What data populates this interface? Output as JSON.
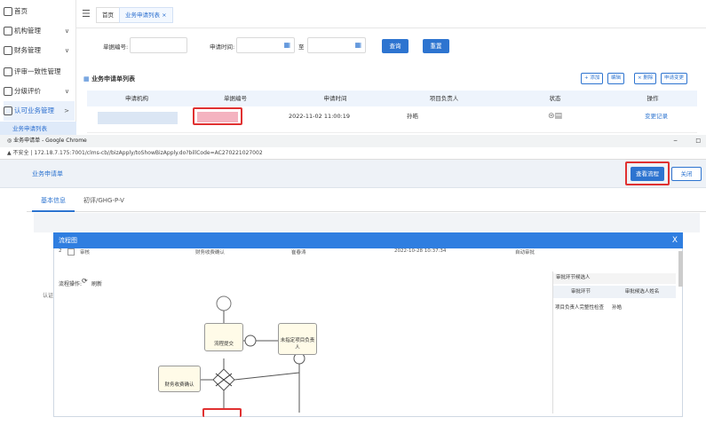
{
  "sidebar": {
    "items": [
      {
        "label": "首页",
        "icon": "home-icon",
        "chev": ""
      },
      {
        "label": "机构管理",
        "icon": "org-icon",
        "chev": "∨"
      },
      {
        "label": "财务管理",
        "icon": "finance-icon",
        "chev": "∨"
      },
      {
        "label": "评审一致性管理",
        "icon": "review-icon",
        "chev": ""
      },
      {
        "label": "分级评价",
        "icon": "grade-icon",
        "chev": "∨"
      },
      {
        "label": "认可业务管理",
        "icon": "business-icon",
        "chev": ">"
      }
    ],
    "sub_item": "业务申请列表",
    "bottom_icons": [
      "doc-icon",
      "doc2-icon"
    ]
  },
  "tabs": [
    {
      "label": "首页"
    },
    {
      "label": "业务申请列表 ×"
    }
  ],
  "search": {
    "bill_label": "单据编号:",
    "time_label": "申请时间:",
    "to_label": "至",
    "query_btn": "查询",
    "reset_btn": "重置"
  },
  "list": {
    "title": "业务申请单列表",
    "toolbar": [
      "+ 添加",
      "编辑",
      "× 删除",
      "申请变更"
    ],
    "columns": [
      "申请机构",
      "单据编号",
      "申请时间",
      "项目负责人",
      "状态",
      "操作"
    ],
    "row": {
      "apply_time": "2022-11-02 11:00:19",
      "owner": "孙皓",
      "action": "变更记录"
    }
  },
  "chrome": {
    "title": "业务申请单 - Google Chrome",
    "insecure": "不安全",
    "url": "172.18.7.175:7001/clms-cb//bizApply/toShowBizApply.do?billCode=AC270221027002",
    "win_min": "−",
    "win_max": "□"
  },
  "app": {
    "heading": "业务申请单",
    "view_flow_btn": "查看流程",
    "close_btn": "关闭",
    "inner_tabs": [
      "基本信息",
      "初评/GHG-P-V"
    ],
    "left_label": "认证"
  },
  "modal": {
    "title": "流程图",
    "close": "X",
    "peek_row": {
      "no": "2",
      "a": "审核",
      "b": "财务收费确认",
      "c": "崔春涛",
      "d": "2022-10-28 10:37:34",
      "e": "自动审批"
    },
    "ops_label": "流程操作:",
    "refresh": "刷新",
    "right_panel": {
      "title": "审批环节候选人",
      "col1": "审批环节",
      "col2": "审批候选人姓名",
      "row_step": "项目负责人完整性检查",
      "row_name": "孙皓"
    },
    "nodes": {
      "submit": "流程提交",
      "assign": "未指定项目负责人",
      "finance": "财务收费确认"
    }
  },
  "colors": {
    "accent": "#2d74d0",
    "highlight": "#e03131",
    "modal_head": "#2f7ee0"
  }
}
